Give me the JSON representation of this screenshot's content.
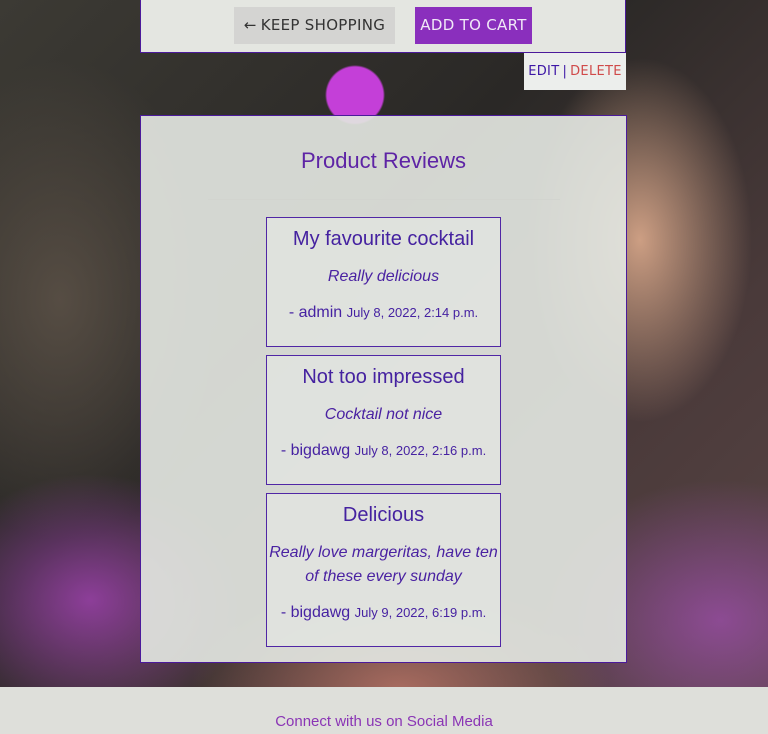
{
  "actions": {
    "keep_shopping_label": "KEEP SHOPPING",
    "keep_shopping_icon": "arrow-left-icon",
    "add_to_cart_label": "ADD TO CART",
    "edit_label": "EDIT",
    "separator": "|",
    "delete_label": "DELETE"
  },
  "reviews": {
    "title": "Product Reviews",
    "items": [
      {
        "title": "My favourite cocktail",
        "body": "Really delicious",
        "author_prefix": "- ",
        "author": "admin",
        "date": "July 8, 2022, 2:14 p.m."
      },
      {
        "title": "Not too impressed",
        "body": "Cocktail not nice",
        "author_prefix": "- ",
        "author": "bigdawg",
        "date": "July 8, 2022, 2:16 p.m."
      },
      {
        "title": "Delicious",
        "body": "Really love margeritas, have ten of these every sunday",
        "author_prefix": "- ",
        "author": "bigdawg",
        "date": "July 9, 2022, 6:19 p.m."
      }
    ]
  },
  "footer": {
    "text": "Connect with us on Social Media"
  },
  "colors": {
    "accent": "#8a2fbd",
    "review_text": "#4522a0",
    "delete": "#d04a4a",
    "panel_border": "#4b1a9b"
  }
}
